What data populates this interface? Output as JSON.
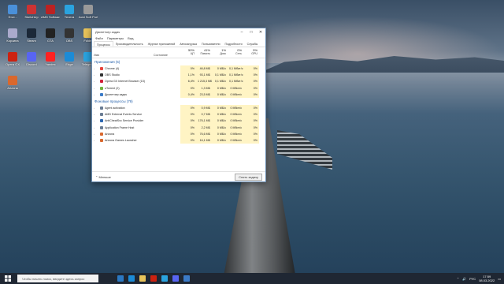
{
  "task_manager": {
    "title": "Диспетчер задач",
    "menu": [
      "Файл",
      "Параметры",
      "Вид"
    ],
    "tabs": [
      "Процессы",
      "Производительность",
      "Журнал приложений",
      "Автозагрузка",
      "Пользователи",
      "Подробности",
      "Службы"
    ],
    "columns": {
      "name": "Имя",
      "status": "Состояние",
      "cpu_pct": "50%",
      "cpu": "ЦП",
      "mem_pct": "41%",
      "mem": "Память",
      "disk_pct": "1%",
      "disk": "Диск",
      "net_pct": "0%",
      "net": "Сеть",
      "gpu_pct": "5%",
      "gpu": "GPU"
    },
    "group_apps": "Приложения (5)",
    "apps": [
      {
        "name": "Chrome (4)",
        "cpu": "0%",
        "mem": "46,8 МБ",
        "disk": "0 МБ/с",
        "net": "0,1 Мбит/с",
        "gpu": "0%",
        "color": "#e8453c"
      },
      {
        "name": "OBS Studio",
        "cpu": "1,1%",
        "mem": "93,1 МБ",
        "disk": "0,1 МБ/с",
        "net": "0,1 Мбит/с",
        "gpu": "0%",
        "color": "#303030"
      },
      {
        "name": "Opera GX Internet Browser (15)",
        "cpu": "6,4%",
        "mem": "1 215,3 МБ",
        "disk": "0,1 МБ/с",
        "net": "0,1 Мбит/с",
        "gpu": "0%",
        "color": "#d2213a"
      },
      {
        "name": "uTorrent (2)",
        "cpu": "0%",
        "mem": "1,3 МБ",
        "disk": "0 МБ/с",
        "net": "0 Мбит/с",
        "gpu": "0%",
        "color": "#72b33e"
      },
      {
        "name": "Диспетчер задач",
        "cpu": "0,4%",
        "mem": "23,5 МБ",
        "disk": "0 МБ/с",
        "net": "0 Мбит/с",
        "gpu": "0%",
        "color": "#3b7bc8"
      }
    ],
    "group_bg": "Фоновые процессы (79)",
    "bg": [
      {
        "name": "Agent activation",
        "cpu": "0%",
        "mem": "0,9 МБ",
        "disk": "0 МБ/с",
        "net": "0 Мбит/с",
        "gpu": "0%",
        "color": "#6a7c93"
      },
      {
        "name": "AMD External Events Service",
        "cpu": "0%",
        "mem": "0,7 МБ",
        "disk": "0 МБ/с",
        "net": "0 Мбит/с",
        "gpu": "0%",
        "color": "#6a7c93"
      },
      {
        "name": "AntiCheatSvc Service Provider",
        "cpu": "0%",
        "mem": "176,1 МБ",
        "disk": "0 МБ/с",
        "net": "0 Мбит/с",
        "gpu": "0%",
        "color": "#2c66b0"
      },
      {
        "name": "Application Frame Host",
        "cpu": "0%",
        "mem": "2,2 МБ",
        "disk": "0 МБ/с",
        "net": "0 Мбит/с",
        "gpu": "0%",
        "color": "#6a7c93"
      },
      {
        "name": "Arizona",
        "cpu": "0%",
        "mem": "76,6 МБ",
        "disk": "0 МБ/с",
        "net": "0 Мбит/с",
        "gpu": "0%",
        "color": "#d9682e"
      },
      {
        "name": "Arizona Games Launcher",
        "cpu": "0%",
        "mem": "16,1 МБ",
        "disk": "0 МБ/с",
        "net": "0 Мбит/с",
        "gpu": "0%",
        "color": "#d9682e"
      }
    ],
    "footer_less": "Меньше",
    "footer_end": "Снять задачу"
  },
  "taskbar": {
    "search_placeholder": "Чтобы начать поиск, введите здесь запрос",
    "clock_time": "17:59",
    "clock_date": "08.03.2022",
    "lang": "РУС"
  },
  "desktop_icons": [
    {
      "label": "Этот...",
      "color": "#4a90d9"
    },
    {
      "label": "SketchUp",
      "color": "#c33"
    },
    {
      "label": "AMD Software",
      "color": "#b22"
    },
    {
      "label": "Телега",
      "color": "#2aa3df"
    },
    {
      "label": "Acid Soft Portable",
      "color": "#999"
    },
    {
      "label": "Корзина",
      "color": "#aac"
    },
    {
      "label": "Steam",
      "color": "#1b2838"
    },
    {
      "label": "GTA",
      "color": "#222"
    },
    {
      "label": "OBS",
      "color": "#333"
    },
    {
      "label": "Folder",
      "color": "#e8c35a"
    },
    {
      "label": "Opera GX",
      "color": "#c21"
    },
    {
      "label": "Discord",
      "color": "#5865f2"
    },
    {
      "label": "Yandex",
      "color": "#f22"
    },
    {
      "label": "Edge",
      "color": "#1c8bd6"
    },
    {
      "label": "Telegram",
      "color": "#2aa3df"
    },
    {
      "label": "Arizona",
      "color": "#d9682e"
    }
  ]
}
